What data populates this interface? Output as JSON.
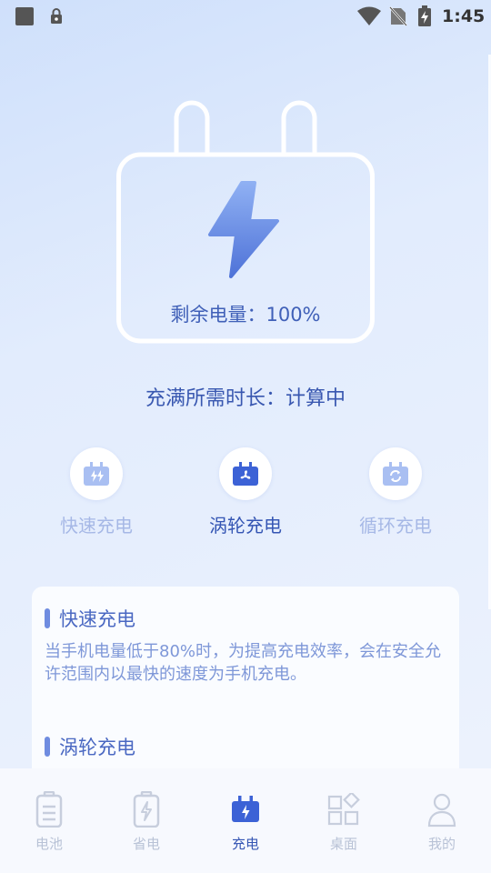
{
  "status_bar": {
    "time": "1:45"
  },
  "charger": {
    "remaining": "剩余电量：100%"
  },
  "full_time": "充满所需时长：计算中",
  "modes": [
    {
      "label": "快速充电",
      "icon": "fast-charge-icon"
    },
    {
      "label": "涡轮充电",
      "icon": "turbo-fan-icon"
    },
    {
      "label": "循环充电",
      "icon": "cycle-charge-icon"
    }
  ],
  "active_mode": "涡轮充电",
  "info": {
    "fast": {
      "title": "快速充电",
      "desc": "当手机电量低于80%时，为提高充电效率，会在安全允许范围内以最快的速度为手机充电。"
    },
    "turbo": {
      "title": "涡轮充电"
    }
  },
  "tabs": [
    {
      "label": "电池",
      "icon": "battery-icon"
    },
    {
      "label": "省电",
      "icon": "power-save-icon"
    },
    {
      "label": "充电",
      "icon": "charge-icon"
    },
    {
      "label": "桌面",
      "icon": "desktop-grid-icon"
    },
    {
      "label": "我的",
      "icon": "user-icon"
    }
  ],
  "active_tab": "充电",
  "colors": {
    "accent": "#3556b4",
    "muted": "#a6b8e6",
    "icon_blue": "#7a96e6"
  }
}
